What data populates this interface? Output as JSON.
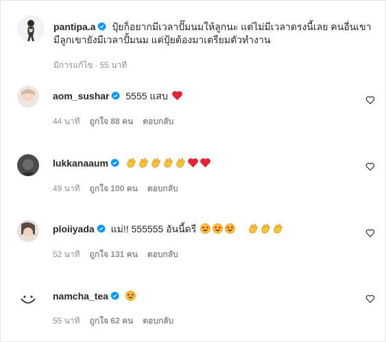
{
  "post": {
    "username": "pantipa.a",
    "caption": "ปุ้ยก็อยากมีเวลาปั๊มนมให้ลูกนะ แต่ไม่มีเวลาตรงนี้เลย คนอื่นเขามีลูกเขายังมีเวลาปั้มนม แต่ปุ้ยต้องมาเตรียมตัวทำงาน",
    "edited": "มีการแก้ไข",
    "separator": "·",
    "time": "55 นาที"
  },
  "comments": [
    {
      "username": "aom_sushar",
      "text": "5555 แสบ",
      "emojis": [
        "red-heart"
      ],
      "time": "44 นาที",
      "likes": "ถูกใจ 88 คน",
      "reply": "ตอบกลับ"
    },
    {
      "username": "lukkanaaum",
      "text": "",
      "emojis": [
        "clapping-hands",
        "clapping-hands",
        "clapping-hands",
        "clapping-hands",
        "clapping-hands",
        "red-heart",
        "red-heart"
      ],
      "time": "49 นาที",
      "likes": "ถูกใจ 100 คน",
      "reply": "ตอบกลับ"
    },
    {
      "username": "ploiiyada",
      "text": "แม่!! 555555 อันนี้ดรี",
      "emojis": [
        "star-struck",
        "star-struck",
        "star-struck",
        "space",
        "clapping-hands",
        "clapping-hands",
        "clapping-hands"
      ],
      "time": "52 นาที",
      "likes": "ถูกใจ 131 คน",
      "reply": "ตอบกลับ"
    },
    {
      "username": "namcha_tea",
      "text": "",
      "emojis": [
        "star-struck"
      ],
      "time": "55 นาที",
      "likes": "ถูกใจ 62 คน",
      "reply": "ตอบกลับ"
    }
  ],
  "icons": {
    "verified": "verified-badge-icon",
    "like": "heart-outline-icon"
  },
  "colors": {
    "verified": "#0095f6",
    "meta": "#8e8e8e",
    "text": "#262626",
    "heart": "#ed4956"
  }
}
